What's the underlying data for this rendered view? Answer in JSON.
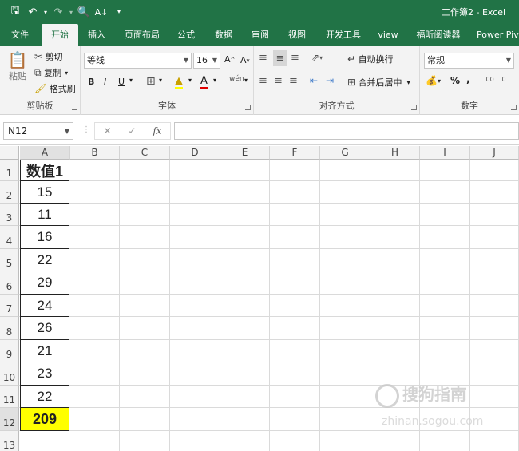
{
  "window": {
    "title": "工作簿2  -  Excel"
  },
  "quick_access": {
    "icons": [
      "save-icon",
      "undo-icon",
      "redo-icon",
      "print-preview-icon",
      "sort-icon",
      "customize-icon"
    ]
  },
  "tabs": [
    {
      "label": "文件"
    },
    {
      "label": "开始"
    },
    {
      "label": "插入"
    },
    {
      "label": "页面布局"
    },
    {
      "label": "公式"
    },
    {
      "label": "数据"
    },
    {
      "label": "审阅"
    },
    {
      "label": "视图"
    },
    {
      "label": "开发工具"
    },
    {
      "label": "view"
    },
    {
      "label": "福昕阅读器"
    },
    {
      "label": "Power Pivo"
    }
  ],
  "active_tab": "开始",
  "ribbon": {
    "clipboard": {
      "label": "剪贴板",
      "paste": "粘贴",
      "cut": "剪切",
      "copy": "复制",
      "format_painter": "格式刷"
    },
    "font": {
      "label": "字体",
      "family": "等线",
      "size": "16"
    },
    "alignment": {
      "label": "对齐方式",
      "wrap": "自动换行",
      "merge": "合并后居中"
    },
    "number": {
      "label": "数字",
      "format": "常规"
    }
  },
  "formula_bar": {
    "name_box": "N12",
    "formula": ""
  },
  "sheet": {
    "columns": [
      "A",
      "B",
      "C",
      "D",
      "E",
      "F",
      "G",
      "H",
      "I",
      "J"
    ],
    "rows": [
      "1",
      "2",
      "3",
      "4",
      "5",
      "6",
      "7",
      "8",
      "9",
      "10",
      "11",
      "12",
      "13"
    ],
    "cells": {
      "A1": "数值1",
      "A2": "15",
      "A3": "11",
      "A4": "16",
      "A5": "22",
      "A6": "29",
      "A7": "24",
      "A8": "26",
      "A9": "21",
      "A10": "23",
      "A11": "22",
      "A12": "209"
    }
  },
  "colors": {
    "brand": "#217346",
    "highlight": "#ffff00"
  },
  "watermark": {
    "text": "搜狗指南",
    "url": "zhinan.sogou.com"
  }
}
